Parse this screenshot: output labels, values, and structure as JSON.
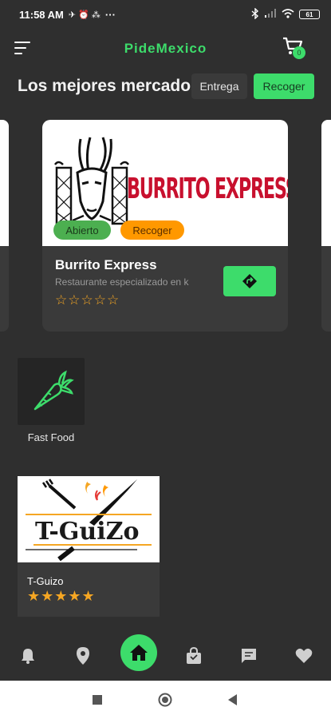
{
  "status_bar": {
    "time": "11:58 AM",
    "notification_icons": "✈ ⏰ ⁂",
    "dots": "···",
    "battery": "61"
  },
  "app_bar": {
    "title": "PideMexico",
    "cart_count": "0"
  },
  "section": {
    "heading": "Los mejores mercados",
    "toggle_delivery": "Entrega",
    "toggle_pickup": "Recoger"
  },
  "featured": {
    "logo_text": "BURRITO EXPRESS",
    "badge_open": "Abierto",
    "badge_pickup": "Recoger",
    "name": "Burrito Express",
    "description": "Restaurante especializado en k",
    "stars": "☆☆☆☆☆",
    "rating": 0
  },
  "category": {
    "label": "Fast Food",
    "icon": "carrot-icon"
  },
  "restaurant": {
    "logo_text": "T-GuiZo",
    "name": "T-Guizo",
    "stars": "★★★★★",
    "rating": 5
  },
  "bottom_nav": [
    "bell-icon",
    "location-pin-icon",
    "home-icon",
    "shopping-bag-icon",
    "chat-icon",
    "heart-icon"
  ],
  "colors": {
    "accent": "#3ddc6b",
    "background": "#2f2f2f",
    "card": "#3a3a3a",
    "star": "#f5a623",
    "badge_open": "#4caf50",
    "badge_pickup": "#ff9800"
  }
}
